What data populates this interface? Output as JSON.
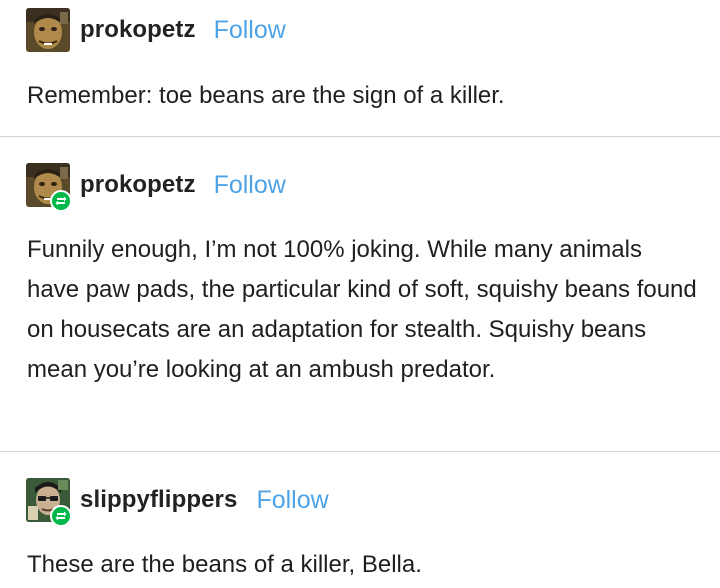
{
  "posts": [
    {
      "username": "prokopetz",
      "follow_label": "Follow",
      "avatar_icon": "avatar-portrait-icon",
      "reblog": false,
      "text": "Remember: toe beans are the sign of a killer."
    },
    {
      "username": "prokopetz",
      "follow_label": "Follow",
      "avatar_icon": "avatar-portrait-icon",
      "reblog": true,
      "reblog_icon": "reblog-icon",
      "text": "Funnily enough, I’m not 100% joking. While many animals have paw pads, the particular kind of soft, squishy beans found on housecats are an adaptation for stealth. Squishy beans mean you’re looking at an ambush predator."
    },
    {
      "username": "slippyflippers",
      "follow_label": "Follow",
      "avatar_icon": "avatar-portrait-icon",
      "reblog": true,
      "reblog_icon": "reblog-icon",
      "text": "These are the beans of a killer, Bella."
    }
  ],
  "colors": {
    "follow_link": "#4ea3e6",
    "reblog_badge": "#00b84a",
    "divider": "#d4d4d4",
    "text": "#1f1f1f"
  }
}
